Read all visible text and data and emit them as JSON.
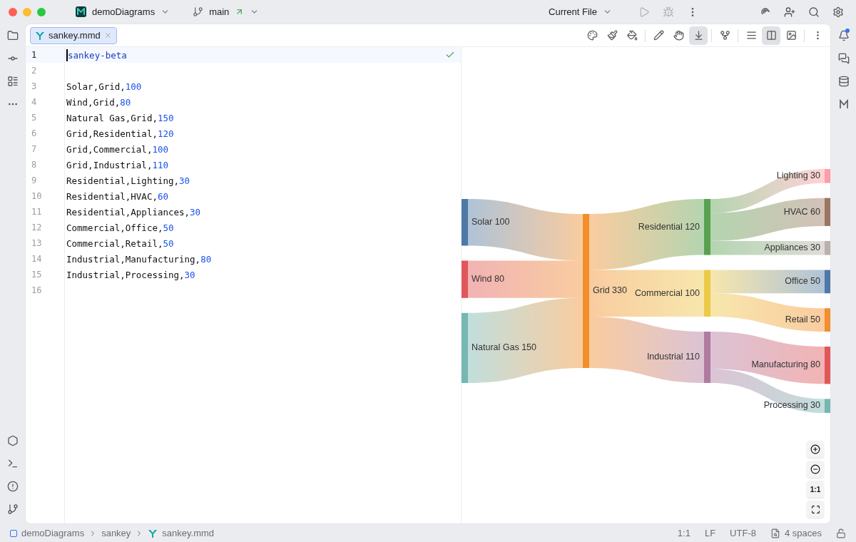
{
  "titlebar": {
    "project": "demoDiagrams",
    "branch": "main",
    "run_config": "Current File"
  },
  "tabs": [
    {
      "label": "sankey.mmd",
      "selected": true
    }
  ],
  "toolbar": [
    {
      "selected": false
    },
    {
      "selected": false
    },
    {
      "selected": false
    },
    {
      "selected": false
    },
    {
      "selected": false
    },
    {
      "selected": true
    },
    {
      "selected": false
    },
    {
      "selected": false
    },
    {
      "selected": true
    },
    {
      "selected": false
    },
    {
      "selected": false
    }
  ],
  "editor": {
    "lines": [
      {
        "number": "1",
        "code": "sankey-beta",
        "kind": "keyword",
        "current": true
      },
      {
        "number": "2",
        "current": false
      },
      {
        "number": "3",
        "code": "Solar,Grid,",
        "value": "100",
        "current": false
      },
      {
        "number": "4",
        "code": "Wind,Grid,",
        "value": "80",
        "current": false
      },
      {
        "number": "5",
        "code": "Natural Gas,Grid,",
        "value": "150",
        "current": false
      },
      {
        "number": "6",
        "code": "Grid,Residential,",
        "value": "120",
        "current": false
      },
      {
        "number": "7",
        "code": "Grid,Commercial,",
        "value": "100",
        "current": false
      },
      {
        "number": "8",
        "code": "Grid,Industrial,",
        "value": "110",
        "current": false
      },
      {
        "number": "9",
        "code": "Residential,Lighting,",
        "value": "30",
        "current": false
      },
      {
        "number": "10",
        "code": "Residential,HVAC,",
        "value": "60",
        "current": false
      },
      {
        "number": "11",
        "code": "Residential,Appliances,",
        "value": "30",
        "current": false
      },
      {
        "number": "12",
        "code": "Commercial,Office,",
        "value": "50",
        "current": false
      },
      {
        "number": "13",
        "code": "Commercial,Retail,",
        "value": "50",
        "current": false
      },
      {
        "number": "14",
        "code": "Industrial,Manufacturing,",
        "value": "80",
        "current": false
      },
      {
        "number": "15",
        "code": "Industrial,Processing,",
        "value": "30",
        "current": false
      },
      {
        "number": "16",
        "current": false
      }
    ]
  },
  "sankey": {
    "sources": [
      {
        "label": "Solar 100",
        "color": "#4e79a7"
      },
      {
        "label": "Wind 80",
        "color": "#e15759"
      },
      {
        "label": "Natural Gas 150",
        "color": "#76b7b2"
      }
    ],
    "hub": {
      "label": "Grid 330",
      "color": "#f28e2b"
    },
    "branches": [
      {
        "label": "Residential 120",
        "color": "#59a14f",
        "children": [
          {
            "label": "Lighting 30",
            "color": "#ff9da7"
          },
          {
            "label": "HVAC 60",
            "color": "#9c755f"
          },
          {
            "label": "Appliances 30",
            "color": "#bab0ac"
          }
        ]
      },
      {
        "label": "Commercial 100",
        "color": "#edc948",
        "children": [
          {
            "label": "Office 50",
            "color": "#4e79a7"
          },
          {
            "label": "Retail 50",
            "color": "#f28e2b"
          }
        ]
      },
      {
        "label": "Industrial 110",
        "color": "#b07aa1",
        "children": [
          {
            "label": "Manufacturing 80",
            "color": "#e15759"
          },
          {
            "label": "Processing 30",
            "color": "#76b7b2"
          }
        ]
      }
    ]
  },
  "zoom_controls": {
    "actual_size": "1:1"
  },
  "breadcrumbs": [
    "demoDiagrams",
    "sankey",
    "sankey.mmd"
  ],
  "status": {
    "position": "1:1",
    "line_ending": "LF",
    "encoding": "UTF-8",
    "indent": "4 spaces"
  }
}
